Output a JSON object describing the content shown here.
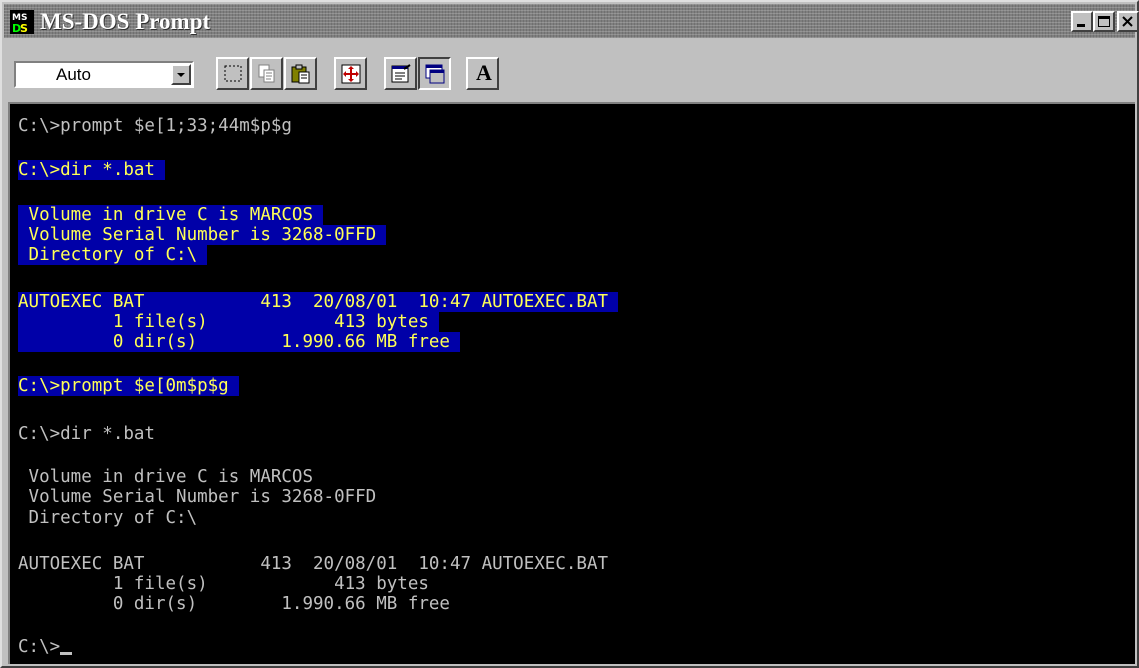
{
  "window": {
    "title": "MS-DOS Prompt",
    "icon": "ms-dos-icon",
    "controls": [
      "minimize-icon",
      "maximize-icon",
      "close-icon"
    ]
  },
  "toolbar": {
    "font_size_value": "Auto",
    "buttons": [
      "mark-icon",
      "copy-icon",
      "paste-icon",
      "fullscreen-icon",
      "properties-icon",
      "background-icon",
      "font-icon"
    ],
    "font_button_label": "A"
  },
  "console": {
    "colors": {
      "background": "#000000",
      "text": "#c0c0c0",
      "highlight_bg": "#0000a8",
      "highlight_text": "#ffff55"
    },
    "lines": [
      "C:\\>prompt $e[1;33;44m$p$g",
      "C:\\>dir *.bat",
      " Volume in drive C is MARCOS",
      " Volume Serial Number is 3268-0FFD",
      " Directory of C:\\",
      "AUTOEXEC BAT           413  20/08/01  10:47 AUTOEXEC.BAT",
      "         1 file(s)            413 bytes",
      "         0 dir(s)        1.990.66 MB free",
      "C:\\>prompt $e[0m$p$g",
      "C:\\>dir *.bat",
      " Volume in drive C is MARCOS",
      " Volume Serial Number is 3268-0FFD",
      " Directory of C:\\",
      "AUTOEXEC BAT           413  20/08/01  10:47 AUTOEXEC.BAT",
      "         1 file(s)            413 bytes",
      "         0 dir(s)        1.990.66 MB free",
      "C:\\>"
    ]
  }
}
